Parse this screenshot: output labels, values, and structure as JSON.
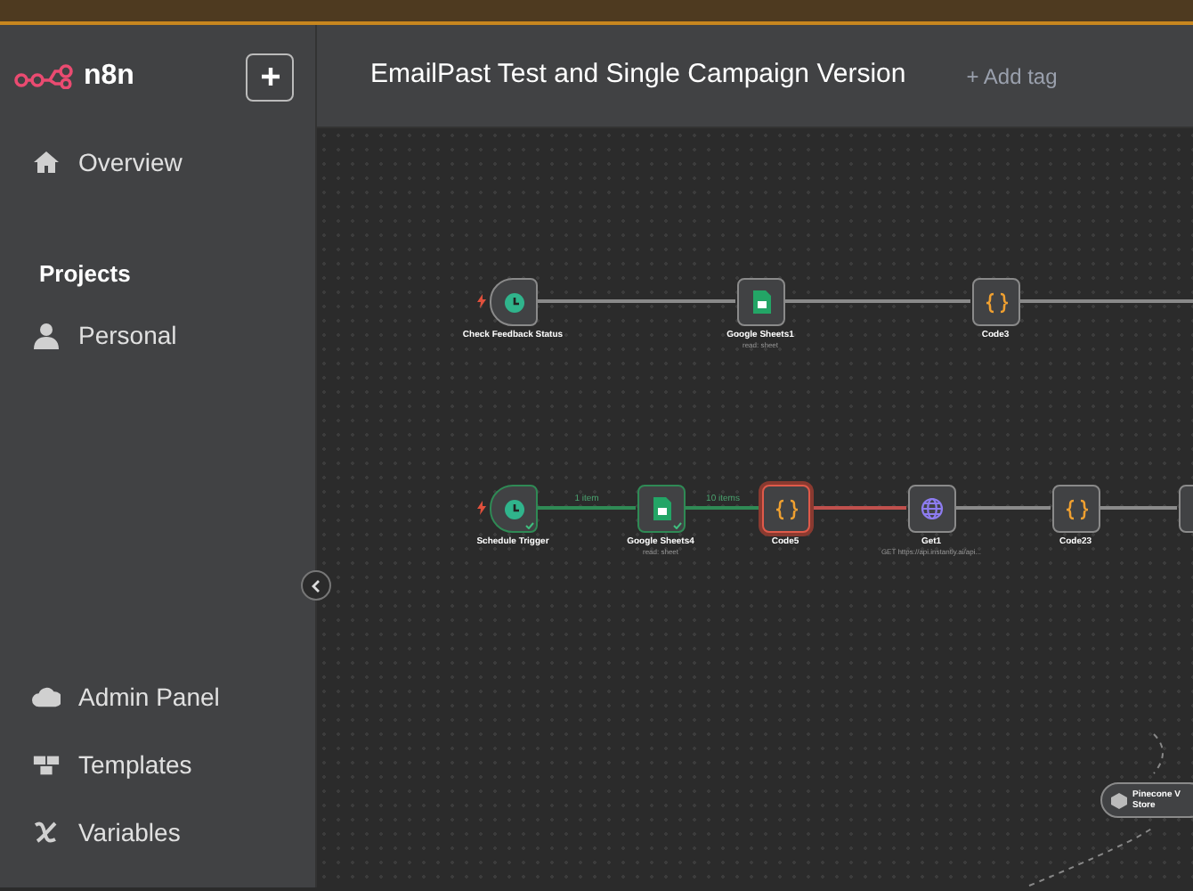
{
  "sidebar": {
    "logo": "n8n",
    "top_items": [
      {
        "label": "Overview"
      }
    ],
    "section_title": "Projects",
    "project_items": [
      {
        "label": "Personal"
      }
    ],
    "bottom_items": [
      {
        "label": "Admin Panel"
      },
      {
        "label": "Templates"
      },
      {
        "label": "Variables"
      }
    ]
  },
  "header": {
    "title": "EmailPast Test and Single Campaign Version",
    "add_tag": "+ Add tag"
  },
  "nodes": [
    {
      "kind": "trigger",
      "label": "Check Feedback Status",
      "succeeded": false,
      "failed": false
    },
    {
      "kind": "sheets",
      "label": "Google Sheets1",
      "subtitle": "read: sheet",
      "succeeded": false,
      "failed": false
    },
    {
      "kind": "code",
      "label": "Code3",
      "succeeded": false,
      "failed": false
    },
    {
      "kind": "trigger",
      "label": "Schedule Trigger",
      "succeeded": true,
      "failed": false
    },
    {
      "kind": "sheets",
      "label": "Google Sheets4",
      "subtitle": "read: sheet",
      "succeeded": true,
      "failed": false
    },
    {
      "kind": "code",
      "label": "Code5",
      "succeeded": false,
      "failed": true
    },
    {
      "kind": "http",
      "label": "Get1",
      "subtitle": "GET https://api.instantly.ai/api...",
      "succeeded": false,
      "failed": false
    },
    {
      "kind": "code",
      "label": "Code23",
      "succeeded": false,
      "failed": false
    },
    {
      "kind": "partial",
      "succeeded": false,
      "failed": false
    },
    {
      "kind": "vector",
      "label": "Pinecone V",
      "label_line2": "Store",
      "succeeded": false,
      "failed": false
    }
  ],
  "connections": [
    {
      "succeeded": false,
      "failed": false
    },
    {
      "succeeded": false,
      "failed": false
    },
    {
      "succeeded": false,
      "failed": false
    },
    {
      "succeeded": true,
      "failed": false,
      "label": "1 item"
    },
    {
      "succeeded": true,
      "failed": false,
      "label": "10 items"
    },
    {
      "succeeded": false,
      "failed": true
    },
    {
      "succeeded": false,
      "failed": false
    },
    {
      "succeeded": false,
      "failed": false
    }
  ]
}
